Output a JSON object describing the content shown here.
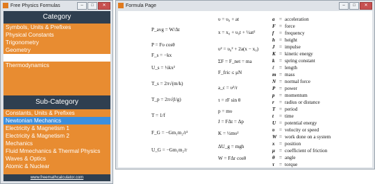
{
  "left_window": {
    "title": "Free Physics Formulas",
    "category_header": "Category",
    "categories": [
      {
        "label": "Symbols, Units & Prefixes"
      },
      {
        "label": "Physical Constants"
      },
      {
        "label": "Trigonometry"
      },
      {
        "label": "Geometry"
      },
      {
        "label": ""
      },
      {
        "label": "Thermodynamics"
      }
    ],
    "subcategory_header": "Sub-Category",
    "subcategories": [
      {
        "label": "Constants, Units & Prefixes"
      },
      {
        "label": "Newtonian Mechanics"
      },
      {
        "label": "Electricity & Magnetism 1"
      },
      {
        "label": "Electricity & Magnetism 2"
      },
      {
        "label": "Mechanics"
      },
      {
        "label": "Fluid Mmechanics & Thermal Physics"
      },
      {
        "label": "Waves & Optics"
      },
      {
        "label": "Atomic & Nuclear"
      }
    ],
    "footer_link": "www.freemathcalculator.com"
  },
  "right_window": {
    "title": "Formula Page",
    "col1": [
      "P_avg = W/Δt",
      "P = Fυ cosθ",
      "F_s = −kx",
      "U_s = ½kx²",
      "T_s = 2π√(m/k)",
      "T_p = 2π√(l/g)",
      "T = 1/f",
      "F_G = −Gm₁m₂/r²",
      "U_G = −Gm₁m₂/r"
    ],
    "col2": [
      "υ = υ₀ + at",
      "x = x₀ + υ₀t + ½at²",
      "υ² = υ₀² + 2a(x − x₀)",
      "ΣF = F_net = ma",
      "F_fric ≤ μN",
      "a_c = υ²/r",
      "τ = rF sin θ",
      "p = mυ",
      "J = FΔt = Δp",
      "K = ½mυ²",
      "ΔU_g = mgh",
      "W = FΔr cosθ"
    ],
    "legend": [
      {
        "sym": "a",
        "desc": "acceleration"
      },
      {
        "sym": "F",
        "desc": "force"
      },
      {
        "sym": "f",
        "desc": "frequency"
      },
      {
        "sym": "h",
        "desc": "height"
      },
      {
        "sym": "J",
        "desc": "impulse"
      },
      {
        "sym": "K",
        "desc": "kinetic energy"
      },
      {
        "sym": "k",
        "desc": "spring constant"
      },
      {
        "sym": "ℓ",
        "desc": "length"
      },
      {
        "sym": "m",
        "desc": "mass"
      },
      {
        "sym": "N",
        "desc": "normal force"
      },
      {
        "sym": "P",
        "desc": "power"
      },
      {
        "sym": "p",
        "desc": "momentum"
      },
      {
        "sym": "r",
        "desc": "radius or distance"
      },
      {
        "sym": "T",
        "desc": "period"
      },
      {
        "sym": "t",
        "desc": "time"
      },
      {
        "sym": "U",
        "desc": "potential energy"
      },
      {
        "sym": "υ",
        "desc": "velocity or speed"
      },
      {
        "sym": "W",
        "desc": "work done on a system"
      },
      {
        "sym": "x",
        "desc": "position"
      },
      {
        "sym": "μ",
        "desc": "coefficient of friction"
      },
      {
        "sym": "θ",
        "desc": "angle"
      },
      {
        "sym": "τ",
        "desc": "torque"
      }
    ]
  },
  "colors": {
    "panel": "#e88c31",
    "header": "#2f3f50",
    "selected": "#3c8fde"
  }
}
